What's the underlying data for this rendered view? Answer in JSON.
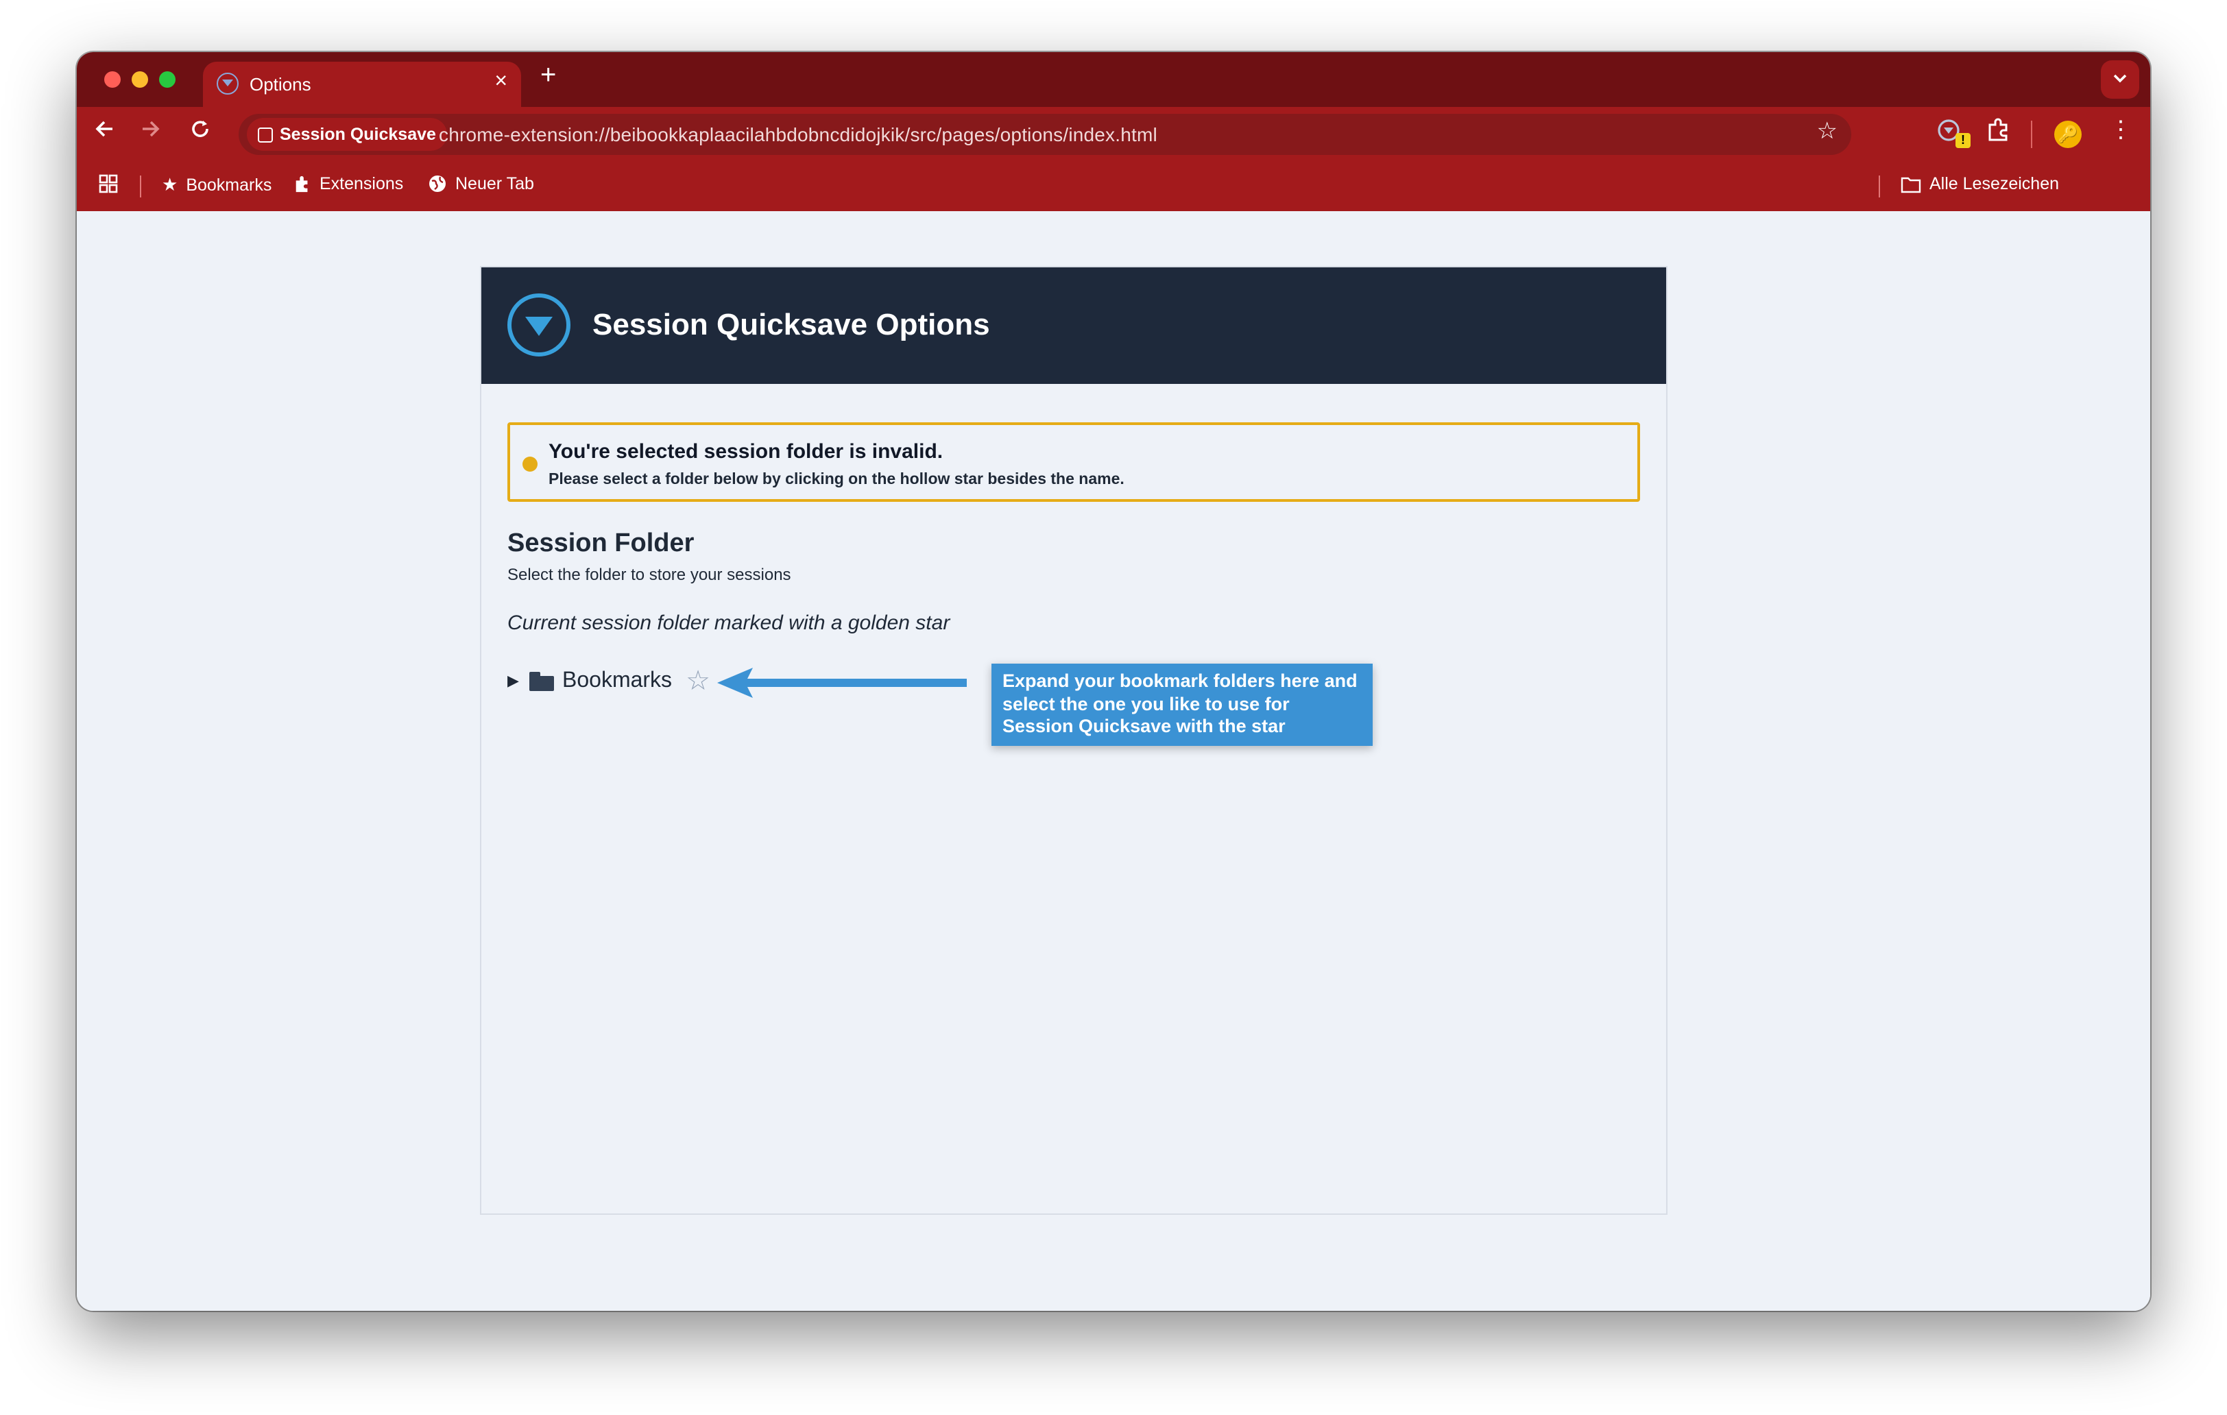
{
  "browser": {
    "tab_title": "Options",
    "tab_close": "×",
    "new_tab": "+",
    "tab_menu": "⌄",
    "chip_label": "Session Quicksave",
    "url": "chrome-extension://beibookkaplaacilahbdobncdidojkik/src/pages/options/index.html",
    "ext_badge": "!",
    "bookmarks": [
      {
        "label": "Bookmarks",
        "icon": "star-icon"
      },
      {
        "label": "Extensions",
        "icon": "puzzle-icon"
      },
      {
        "label": "Neuer Tab",
        "icon": "globe-icon"
      }
    ],
    "all_bookmarks": "Alle Lesezeichen"
  },
  "page": {
    "title": "Session Quicksave Options",
    "warning": {
      "heading": "You're selected session folder is invalid.",
      "text": "Please select a folder below by clicking on the hollow star besides the name.",
      "color": "#e5ac17"
    },
    "section_title": "Session Folder",
    "section_sub": "Select the folder to store your sessions",
    "hint": "Current session folder marked with a golden star",
    "tree": [
      {
        "label": "Bookmarks",
        "expanded": false
      }
    ],
    "callout": "Expand your bookmark folders here and select the one you like to use for Session Quicksave with the star",
    "colors": {
      "header": "#1e293b",
      "accent": "#38a0dc",
      "callout": "#3b92d4",
      "chrome": "#a31a1c"
    }
  }
}
